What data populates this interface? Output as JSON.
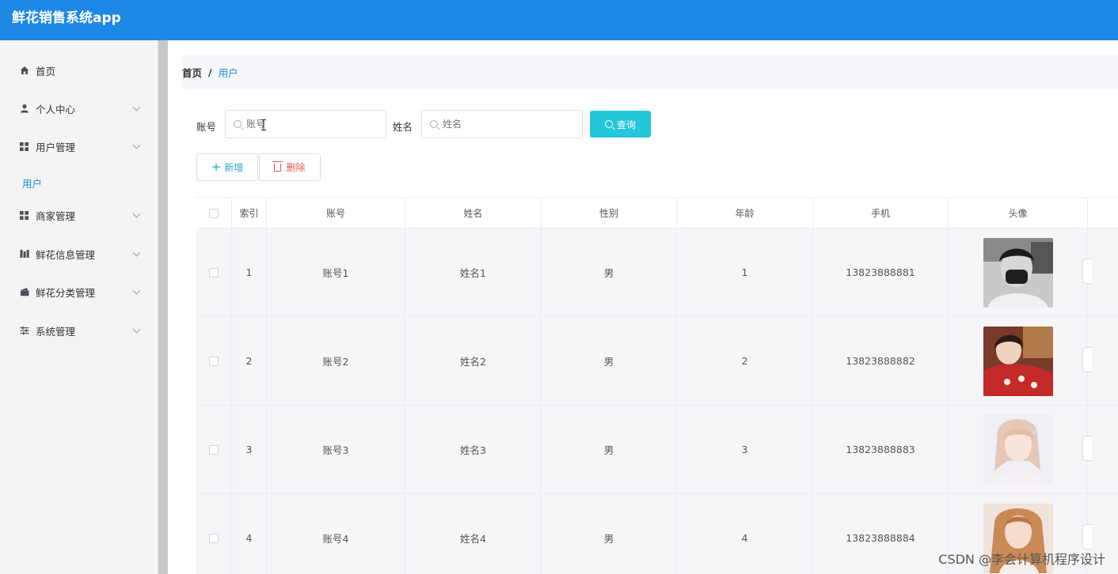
{
  "app": {
    "title": "鲜花销售系统app"
  },
  "sidebar": {
    "items": [
      {
        "label": "首页",
        "icon": "home-icon",
        "expandable": false
      },
      {
        "label": "个人中心",
        "icon": "user-icon",
        "expandable": true
      },
      {
        "label": "用户管理",
        "icon": "grid-icon",
        "expandable": true
      },
      {
        "label": "商家管理",
        "icon": "grid-icon",
        "expandable": true
      },
      {
        "label": "鲜花信息管理",
        "icon": "chart-icon",
        "expandable": true
      },
      {
        "label": "鲜花分类管理",
        "icon": "wallet-icon",
        "expandable": true
      },
      {
        "label": "系统管理",
        "icon": "sliders-icon",
        "expandable": true
      }
    ],
    "subitem": {
      "label": "用户"
    }
  },
  "breadcrumb": {
    "home": "首页",
    "separator": "/",
    "current": "用户"
  },
  "search": {
    "account_label": "账号",
    "account_placeholder": "账号",
    "name_label": "姓名",
    "name_placeholder": "姓名",
    "query_label": "查询"
  },
  "toolbar": {
    "add_label": "新增",
    "delete_label": "删除"
  },
  "table": {
    "columns": [
      "索引",
      "账号",
      "姓名",
      "性别",
      "年龄",
      "手机",
      "头像"
    ],
    "rows": [
      {
        "index": "1",
        "account": "账号1",
        "name": "姓名1",
        "gender": "男",
        "age": "1",
        "phone": "13823888881",
        "avatar": "avatar-photo-1"
      },
      {
        "index": "2",
        "account": "账号2",
        "name": "姓名2",
        "gender": "男",
        "age": "2",
        "phone": "13823888882",
        "avatar": "avatar-photo-2"
      },
      {
        "index": "3",
        "account": "账号3",
        "name": "姓名3",
        "gender": "男",
        "age": "3",
        "phone": "13823888883",
        "avatar": "avatar-photo-3"
      },
      {
        "index": "4",
        "account": "账号4",
        "name": "姓名4",
        "gender": "男",
        "age": "4",
        "phone": "13823888884",
        "avatar": "avatar-photo-4"
      }
    ]
  },
  "watermark": "CSDN @李会计算机程序设计",
  "colors": {
    "accent": "#1e88e5",
    "query_button": "#26c6da",
    "danger": "#e05555"
  }
}
